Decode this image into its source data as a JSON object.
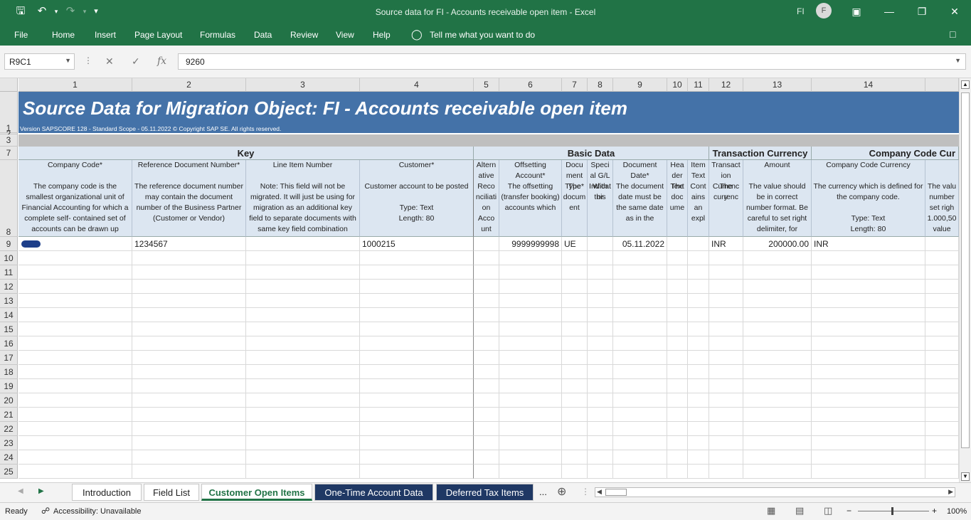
{
  "window": {
    "title": "Source data for FI - Accounts receivable open item  -  Excel",
    "account_initials": "FI",
    "avatar_letter": "F"
  },
  "ribbon_tabs": [
    "File",
    "Home",
    "Insert",
    "Page Layout",
    "Formulas",
    "Data",
    "Review",
    "View",
    "Help"
  ],
  "tell_me": "Tell me what you want to do",
  "formula_bar": {
    "name_box": "R9C1",
    "fx": "fx",
    "value": "9260"
  },
  "column_headers": [
    "1",
    "2",
    "3",
    "4",
    "5",
    "6",
    "7",
    "8",
    "9",
    "10",
    "11",
    "12",
    "13",
    "14",
    ""
  ],
  "row_headers": [
    "1",
    "2",
    "3",
    "7",
    "8",
    "9",
    "10",
    "11",
    "12",
    "13",
    "14",
    "15",
    "16",
    "17",
    "18",
    "19",
    "20",
    "21",
    "22",
    "23",
    "24",
    "25"
  ],
  "banner": {
    "title": "Source Data for Migration Object:  FI - Accounts receivable open item",
    "subtitle": "Version SAPSCORE 128 - Standard Scope - 05.11.2022 © Copyright SAP SE. All rights reserved."
  },
  "groups": [
    "Key",
    "Basic Data",
    "Transaction Currency",
    "Company Code Cur"
  ],
  "descriptions": [
    {
      "header": "Company Code*",
      "body": "The company code is the smallest organizational unit of Financial Accounting for which a complete self- contained set of accounts can be drawn up"
    },
    {
      "header": "Reference Document Number*",
      "body": "The reference document number may contain the document number of the Business Partner (Customer or Vendor)"
    },
    {
      "header": "Line Item Number",
      "body": "Note: This field will not be migrated. It will just be using for migration as an additional key field to separate documents with same key field combination"
    },
    {
      "header": "Customer*",
      "body": "Customer account to be posted\n\nType: Text\nLength: 80"
    },
    {
      "header": "Altern ative",
      "body": "Reco nciliati on Acco unt"
    },
    {
      "header": "Offsetting Account*",
      "body": "The offsetting (transfer booking) accounts which"
    },
    {
      "header": "Docu ment Type*",
      "body": "The docum ent"
    },
    {
      "header": "Speci al G/L Indicat or",
      "body": "With this"
    },
    {
      "header": "Document Date*",
      "body": "The document date must be the same date as in the"
    },
    {
      "header": "Hea der Text",
      "body": "The doc ume"
    },
    {
      "header": "Item Text",
      "body": "Cont ains an expl"
    },
    {
      "header": "Transact ion Currenc y",
      "body": "The currenc"
    },
    {
      "header": "Amount",
      "body": "The value should be in correct number format. Be careful to set right delimiter, for"
    },
    {
      "header": "Company Code Currency",
      "body": "The currency which is defined for the company code.\n\nType: Text\nLength: 80"
    },
    {
      "header": "",
      "body": "The valu number set righ 1.000,50 value"
    }
  ],
  "row9": [
    "",
    "1234567",
    "",
    "1000215",
    "",
    "9999999998",
    "UE",
    "",
    "05.11.2022",
    "",
    "",
    "INR",
    "200000.00",
    "INR",
    ""
  ],
  "sheet_tabs": [
    "Introduction",
    "Field List",
    "Customer Open Items",
    "One-Time Account Data",
    "Deferred Tax Items"
  ],
  "more_tabs": "...",
  "status": {
    "ready": "Ready",
    "accessibility": "Accessibility: Unavailable",
    "zoom": "100%"
  },
  "colors": {
    "accent": "#217346",
    "banner": "#4472a8",
    "header_fill": "#dce6f1",
    "dark_tab": "#1f3864"
  }
}
